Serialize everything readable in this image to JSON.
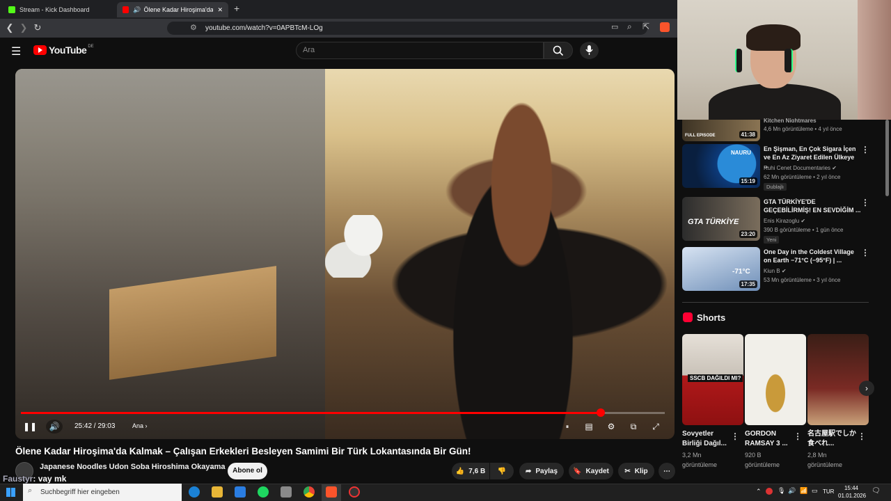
{
  "browser": {
    "tabs": [
      {
        "label": "Stream - Kick Dashboard",
        "color": "#53fc18"
      },
      {
        "label": "Ölene Kadar Hiroşima'da Kalı",
        "color": "#ff0000"
      }
    ],
    "new_tab": "+",
    "url": "youtube.com/watch?v=0APBTcM-LOg"
  },
  "youtube": {
    "logo": "YouTube",
    "region": "DE",
    "search_placeholder": "Ara"
  },
  "player": {
    "progress": 0.9,
    "time": "25:42 / 29:03",
    "chapter": "Ana"
  },
  "video": {
    "title": "Ölene Kadar Hiroşima'da Kalmak – Çalışan Erkekleri Besleyen Samimi Bir Türk Lokantasında Bir Gün!",
    "channel": "Japanese Noodles Udon Soba Hiroshima Okayama",
    "subscribe": "Abone ol",
    "likes": "7,6 B",
    "share": "Paylaş",
    "save": "Kaydet",
    "clip": "Klip"
  },
  "chat": {
    "user": "Faustyr",
    "message": ": vay mk"
  },
  "related": [
    {
      "title": "",
      "channel": "Kitchen Nightmares",
      "meta": "4,6 Mn görüntüleme • 4 yıl önce",
      "duration": "41:38",
      "thumb_text": "FULL EPISODE",
      "colors": [
        "#3d3324",
        "#8a7453"
      ]
    },
    {
      "title": "En Şişman, En Çok Sigara İçen ve En Az Ziyaret Edilen Ülkeye ...",
      "channel": "Ruhi Cenet Documentaries",
      "meta": "62 Mn görüntüleme • 2 yıl önce",
      "badge": "Dublajlı",
      "duration": "15:19",
      "thumb_text": "NAURU",
      "colors": [
        "#0d3a7a",
        "#2a8bd8"
      ]
    },
    {
      "title": "GTA TÜRKİYE'DE GEÇEBİLİRMİŞ! EN SEVDİĞİM ...",
      "channel": "Enis Kirazoglu",
      "meta": "390 B görüntüleme • 1 gün önce",
      "badge": "Yeni",
      "duration": "23:20",
      "thumb_text": "GTA TÜRKİYE",
      "colors": [
        "#2c2c2c",
        "#7a6d5c"
      ]
    },
    {
      "title": "One Day in the Coldest Village on Earth −71°C (−95°F) | ...",
      "channel": "Kiun B",
      "meta": "53 Mn görüntüleme • 3 yıl önce",
      "duration": "17:35",
      "thumb_text": "-71°C",
      "colors": [
        "#6f8fb8",
        "#d7e3f2"
      ]
    }
  ],
  "shorts": {
    "heading": "Shorts",
    "items": [
      {
        "title": "Sovyetler Birliği Dağıl...",
        "views": "3,2 Mn",
        "unit": "görüntüleme",
        "thumb_text": "SSCB DAĞILDI MI?",
        "colors": [
          "#b0191a",
          "#e6e0d8"
        ]
      },
      {
        "title": "GORDON RAMSAY 3 ...",
        "views": "920 B",
        "unit": "görüntüleme",
        "thumb_text": "",
        "colors": [
          "#f1efe9",
          "#c99a3a"
        ]
      },
      {
        "title": "名古屋駅でしか食べれ...",
        "views": "2,8 Mn",
        "unit": "görüntüleme",
        "thumb_text": "",
        "colors": [
          "#3a1e16",
          "#7a2a24"
        ]
      }
    ]
  },
  "taskbar": {
    "search_placeholder": "Suchbegriff hier eingeben",
    "lang": "TUR",
    "time": "15:44",
    "date": "01.01.2026"
  }
}
